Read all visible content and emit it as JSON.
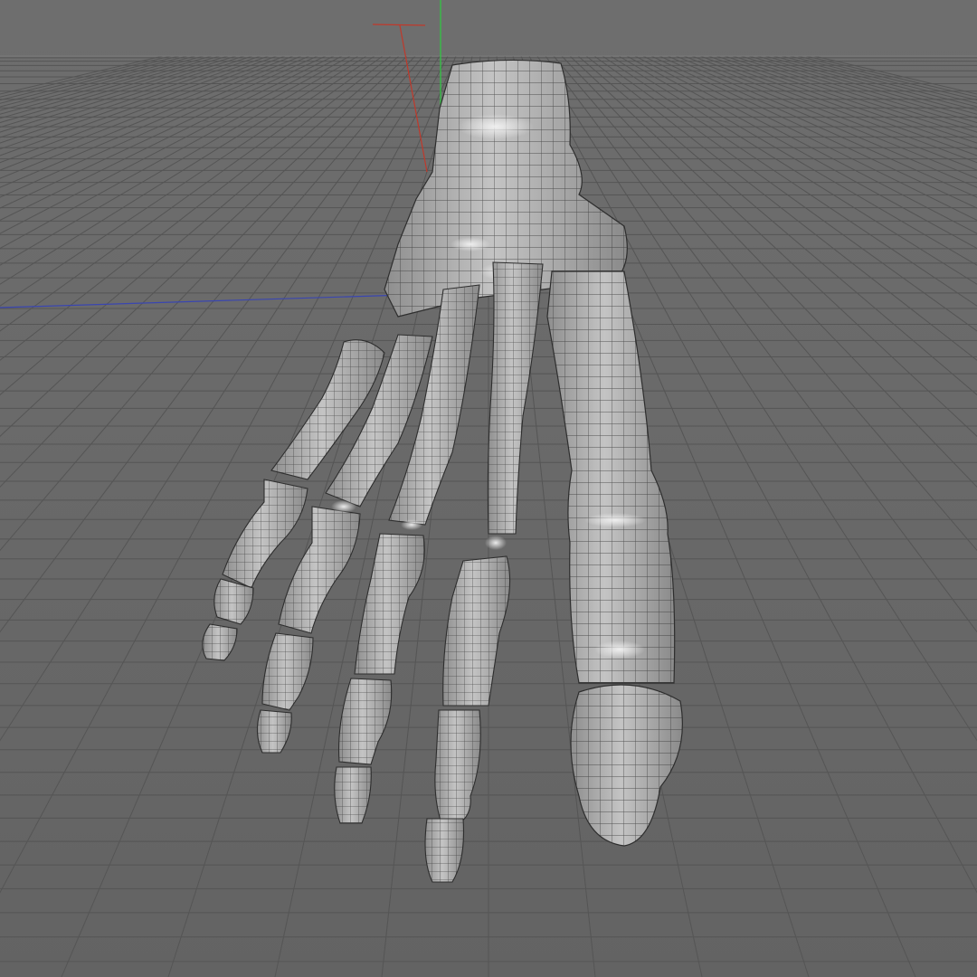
{
  "viewport": {
    "background_color": "#6b6b6b",
    "grid_line_color": "#555555",
    "horizon_color": "#7a7a7a"
  },
  "axes": {
    "x_axis_color": "#c0392b",
    "y_axis_color": "#2ecc40",
    "z_axis_color": "#3a46b0"
  },
  "model": {
    "object": "foot-skeleton-wireframe",
    "fill_color": "#a9a9a9",
    "highlight_color": "#e6e6e6",
    "shadow_color": "#7a7a7a",
    "wire_color": "#2e2e2e",
    "toes": 5
  }
}
